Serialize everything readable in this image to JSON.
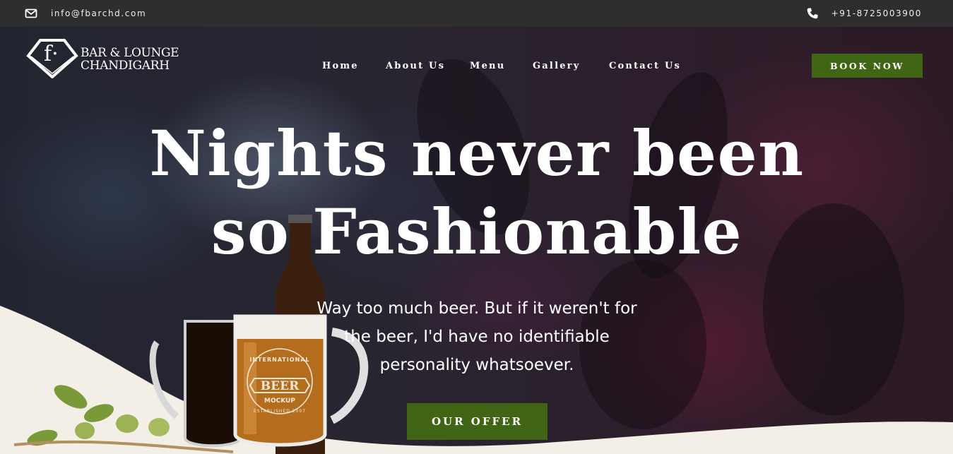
{
  "topbar": {
    "email": "info@fbarchd.com",
    "email_icon": "envelope-icon",
    "phone": "+91-8725003900",
    "phone_icon": "phone-icon"
  },
  "brand": {
    "logo_letter": "f·",
    "line1": "BAR & LOUNGE",
    "line2": "CHANDIGARH"
  },
  "nav": {
    "items": [
      {
        "label": "Home"
      },
      {
        "label": "About Us"
      },
      {
        "label": "Menu"
      },
      {
        "label": "Gallery"
      },
      {
        "label": "Contact Us"
      }
    ],
    "cta": "BOOK NOW"
  },
  "hero": {
    "headline_line1": "Nights never been",
    "headline_line2": "so Fashionable",
    "subtext_line1": "Way too much beer. But if it weren't for",
    "subtext_line2": "the beer, I'd have no identifiable",
    "subtext_line3": "personality whatsoever.",
    "cta": "OUR OFFER",
    "mug_label": {
      "arc_top": "INTERNATIONAL",
      "word": "BEER",
      "sub": "MOCKUP",
      "arc_bottom": "ESTABLISHED 2007"
    }
  },
  "colors": {
    "accent_green": "#3f6515",
    "topbar": "#2e2e2e",
    "cream": "#f3efe6"
  }
}
